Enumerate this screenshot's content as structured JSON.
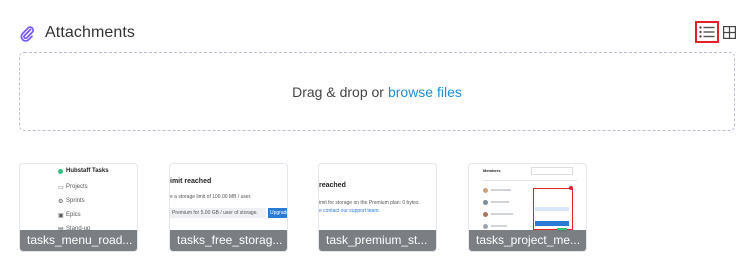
{
  "header": {
    "title": "Attachments",
    "clip_icon": "paperclip-icon",
    "list_view_icon": "list-view-icon",
    "grid_view_icon": "grid-view-icon",
    "active_view": "list",
    "accent_color": "#7a5af5",
    "active_outline_color": "#e2222b"
  },
  "dropzone": {
    "prompt": "Drag & drop or",
    "link": "browse files"
  },
  "attachments": [
    {
      "name": "tasks_menu_road...",
      "preview": [
        "Hubstaff Tasks",
        "Projects",
        "Sprints",
        "Epics",
        "Stand-up"
      ]
    },
    {
      "name": "tasks_free_storag...",
      "preview": [
        "imit reached",
        "e a storage limit of 100.00 MB / user.",
        "Premium for 5.00 GB / user of storage.",
        "Upgrade"
      ]
    },
    {
      "name": "task_premium_st...",
      "preview": [
        "reached",
        "imit for storage on the Premium plan: 0 bytes.",
        "e contact our support team."
      ]
    },
    {
      "name": "tasks_project_me...",
      "preview": [
        "Members"
      ]
    }
  ]
}
